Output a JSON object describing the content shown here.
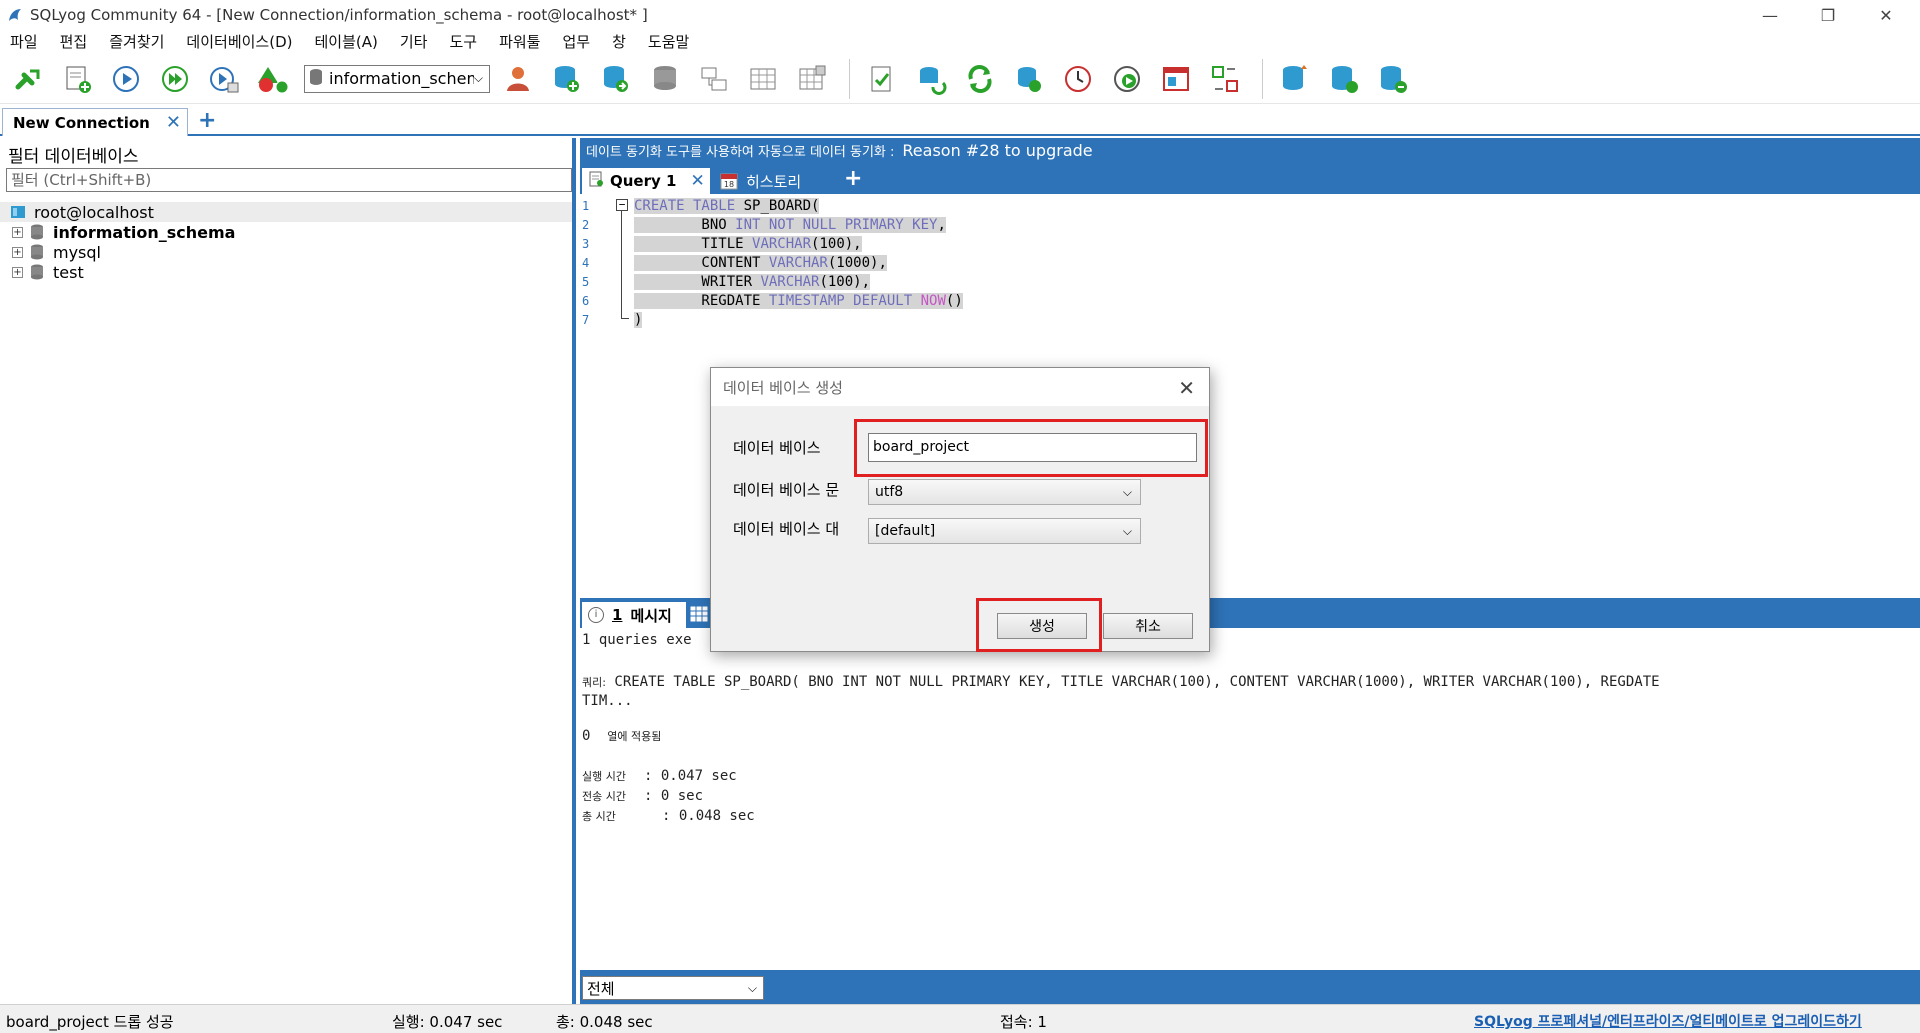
{
  "window": {
    "title": "SQLyog Community 64 - [New Connection/information_schema - root@localhost* ]",
    "minimize": "—",
    "restore": "❐",
    "close": "✕"
  },
  "menu": [
    "파일",
    "편집",
    "즐겨찾기",
    "데이터베이스(D)",
    "테이블(A)",
    "기타",
    "도구",
    "파워툴",
    "업무",
    "창",
    "도움말"
  ],
  "toolbar": {
    "db_select": "information_schem",
    "icons_group1": [
      "new-connection-icon",
      "new-query-icon",
      "execute-query-icon",
      "execute-all-icon",
      "execute-edit-icon",
      "shapes-icon"
    ],
    "icons_group2": [
      "user-manager-icon",
      "create-database-icon",
      "copy-database-icon",
      "database-icon",
      "schema-designer-icon",
      "table-icon",
      "table-grid-icon"
    ],
    "icons_group3": [
      "checklist-icon",
      "sync-icon",
      "refresh-icon",
      "import-icon",
      "clock-icon",
      "schedule-icon",
      "window-icon",
      "diff-icon"
    ],
    "icons_group4": [
      "backup-icon",
      "restore-icon",
      "migration-icon"
    ]
  },
  "connection_tab": {
    "label": "New Connection",
    "close": "✕",
    "add": "+"
  },
  "left_panel": {
    "filter_title": "필터 데이터베이스",
    "filter_placeholder": "필터 (Ctrl+Shift+B)",
    "tree": {
      "root": "root@localhost",
      "databases": [
        {
          "name": "information_schema",
          "bold": true
        },
        {
          "name": "mysql",
          "bold": false
        },
        {
          "name": "test",
          "bold": false
        }
      ]
    }
  },
  "banner": {
    "small_text": "데이트 동기화 도구를 사용하여 자동으로 데이터 동기화 :",
    "large_text": "Reason #28 to upgrade"
  },
  "query_tabs": {
    "query": "Query 1",
    "history": "히스토리",
    "history_day": "18",
    "close": "✕",
    "add": "+"
  },
  "editor": {
    "line_numbers": [
      "1",
      "2",
      "3",
      "4",
      "5",
      "6",
      "7"
    ]
  },
  "result": {
    "tab_count": "1",
    "tab_label": "메시지",
    "queries_line": "1 queries exe",
    "query_prefix": "쿼리:",
    "query_text": "CREATE TABLE SP_BOARD( BNO INT NOT NULL PRIMARY KEY, TITLE VARCHAR(100), CONTENT VARCHAR(1000), WRITER VARCHAR(100), REGDATE",
    "query_text_cont": "TIM...",
    "rows_count": "0",
    "rows_label": "열에 적용됨",
    "exec_label": "실행 시간",
    "exec_value": ": 0.047 sec",
    "transfer_label": "전송 시간",
    "transfer_value": ": 0 sec",
    "total_label": "총 시간",
    "total_value": ": 0.048 sec"
  },
  "bottom_filter": "전체",
  "statusbar": {
    "message": "board_project 드롭 성공",
    "exec": "실행: 0.047 sec",
    "total": "총: 0.048 sec",
    "connections": "접속: 1",
    "upgrade_link": "SQLyog 프로페셔널/엔터프라이즈/얼티메이트로 업그레이드하기"
  },
  "dialog": {
    "title": "데이터 베이스 생성",
    "close": "✕",
    "db_label": "데이터 베이스",
    "db_value": "board_project",
    "charset_label": "데이터 베이스 문",
    "charset_value": "utf8",
    "collation_label": "데이터 베이스 대",
    "collation_value": "[default]",
    "create_button": "생성",
    "cancel_button": "취소",
    "highlight_color": "#e02020"
  },
  "colors": {
    "accent": "#2e73b8",
    "highlight": "#e02020"
  }
}
